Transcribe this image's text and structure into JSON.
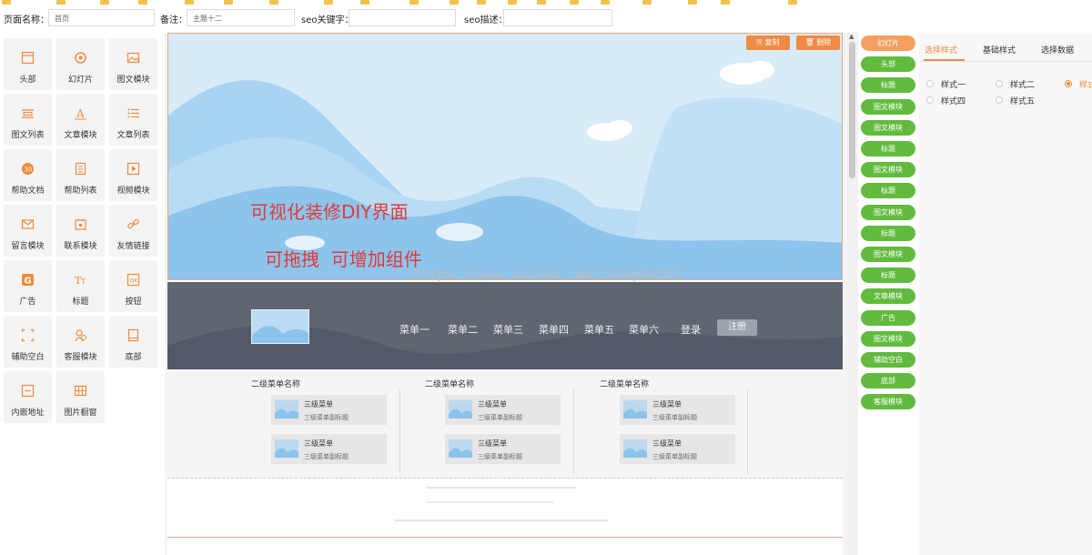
{
  "form": {
    "page_name_label": "页面名称：",
    "page_name_value": "首页",
    "note_label": "备注：",
    "note_value": "主题十二",
    "seo_keywords_label": "seo关键字：",
    "seo_keywords_value": "",
    "seo_desc_label": "seo描述：",
    "seo_desc_value": ""
  },
  "components": [
    {
      "label": "头部",
      "icon": "header-icon"
    },
    {
      "label": "幻灯片",
      "icon": "slideshow-icon"
    },
    {
      "label": "图文模块",
      "icon": "image-text-icon"
    },
    {
      "label": "图文列表",
      "icon": "image-list-icon"
    },
    {
      "label": "文章模块",
      "icon": "article-icon"
    },
    {
      "label": "文章列表",
      "icon": "article-list-icon"
    },
    {
      "label": "帮助文档",
      "icon": "help-doc-icon"
    },
    {
      "label": "帮助列表",
      "icon": "help-list-icon"
    },
    {
      "label": "视频模块",
      "icon": "video-icon"
    },
    {
      "label": "留言模块",
      "icon": "message-icon"
    },
    {
      "label": "联系模块",
      "icon": "contact-icon"
    },
    {
      "label": "友情链接",
      "icon": "link-icon"
    },
    {
      "label": "广告",
      "icon": "ad-icon"
    },
    {
      "label": "标题",
      "icon": "title-icon"
    },
    {
      "label": "按钮",
      "icon": "button-icon"
    },
    {
      "label": "辅助空白",
      "icon": "spacer-icon"
    },
    {
      "label": "客服模块",
      "icon": "service-icon"
    },
    {
      "label": "底部",
      "icon": "footer-icon"
    },
    {
      "label": "内嵌地址",
      "icon": "embed-icon"
    },
    {
      "label": "图片橱窗",
      "icon": "gallery-icon"
    }
  ],
  "banner": {
    "copy_label": "复制",
    "delete_label": "删除",
    "headline": "可视化装修DIY界面",
    "subline": "可拖拽  可增加组件",
    "watermark": "https://www.huzhan.com/ishop44289"
  },
  "nav": {
    "menus": [
      "菜单一",
      "菜单二",
      "菜单三",
      "菜单四",
      "菜单五",
      "菜单六"
    ],
    "login": "登录",
    "register": "注册"
  },
  "submenu": {
    "columns": [
      {
        "title": "二级菜单名称",
        "items": [
          {
            "title": "三级菜单",
            "sub": "三级菜单副标题"
          },
          {
            "title": "三级菜单",
            "sub": "三级菜单副标题"
          }
        ]
      },
      {
        "title": "二级菜单名称",
        "items": [
          {
            "title": "三级菜单",
            "sub": "三级菜单副标题"
          },
          {
            "title": "三级菜单",
            "sub": "三级菜单副标题"
          }
        ]
      },
      {
        "title": "二级菜单名称",
        "items": [
          {
            "title": "三级菜单",
            "sub": "三级菜单副标题"
          },
          {
            "title": "三级菜单",
            "sub": "三级菜单副标题"
          }
        ]
      }
    ]
  },
  "layers": [
    "幻灯片",
    "头部",
    "标题",
    "图文模块",
    "图文模块",
    "标题",
    "图文模块",
    "标题",
    "图文模块",
    "标题",
    "图文模块",
    "标题",
    "文章模块",
    "广告",
    "图文模块",
    "辅助空白",
    "底部",
    "客服模块"
  ],
  "colors": {
    "accent": "#f08a3c",
    "pill_green": "#62bb3e",
    "pill_active": "#f5a060",
    "nav_bg": "#5e6573"
  },
  "props": {
    "tabs": [
      "选择样式",
      "基础样式",
      "选择数据"
    ],
    "styles": [
      "样式一",
      "样式二",
      "样式三",
      "样式四",
      "样式五"
    ],
    "selected_style": "样式三"
  }
}
